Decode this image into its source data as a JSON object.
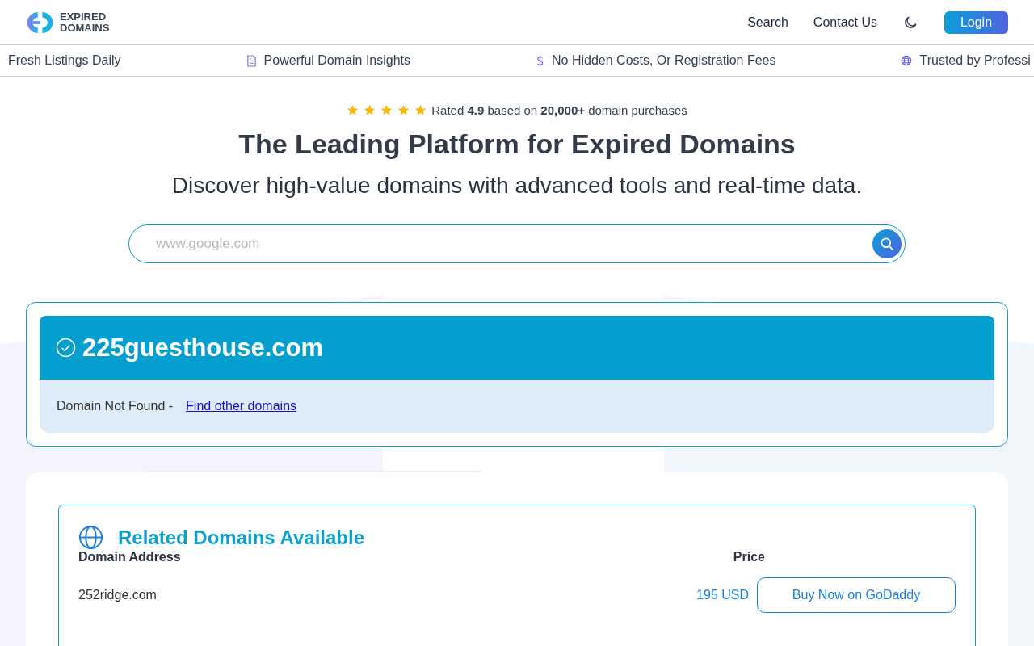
{
  "header": {
    "logo_line_1": "EXPIRED",
    "logo_line_2": "DOMAINS",
    "nav": [
      "Search",
      "Contact Us"
    ],
    "login": "Login"
  },
  "ticker": [
    {
      "text": "Fresh Listings Daily"
    },
    {
      "text": "Powerful Domain Insights"
    },
    {
      "text": "No Hidden Costs, Or Registration Fees"
    },
    {
      "text": "Trusted by Professi"
    }
  ],
  "hero": {
    "stars": 5,
    "rating": "Rated **4.9** based on **20,000+** domain purchases",
    "title": "The Leading Platform for Expired Domains",
    "subtitle": "Discover high-value domains with advanced tools and real-time data.",
    "search": {
      "placeholder": "www.google.com"
    }
  },
  "result": {
    "domain": "225guesthouse.com",
    "status": "Domain Not Found -",
    "link": "Find other domains"
  },
  "related": {
    "title": "Related Domains Available",
    "columns": [
      "Domain Address",
      "Price"
    ],
    "rows": [
      {
        "domain": "252ridge.com",
        "price": "195 USD",
        "action": "Buy Now on GoDaddy"
      }
    ]
  }
}
